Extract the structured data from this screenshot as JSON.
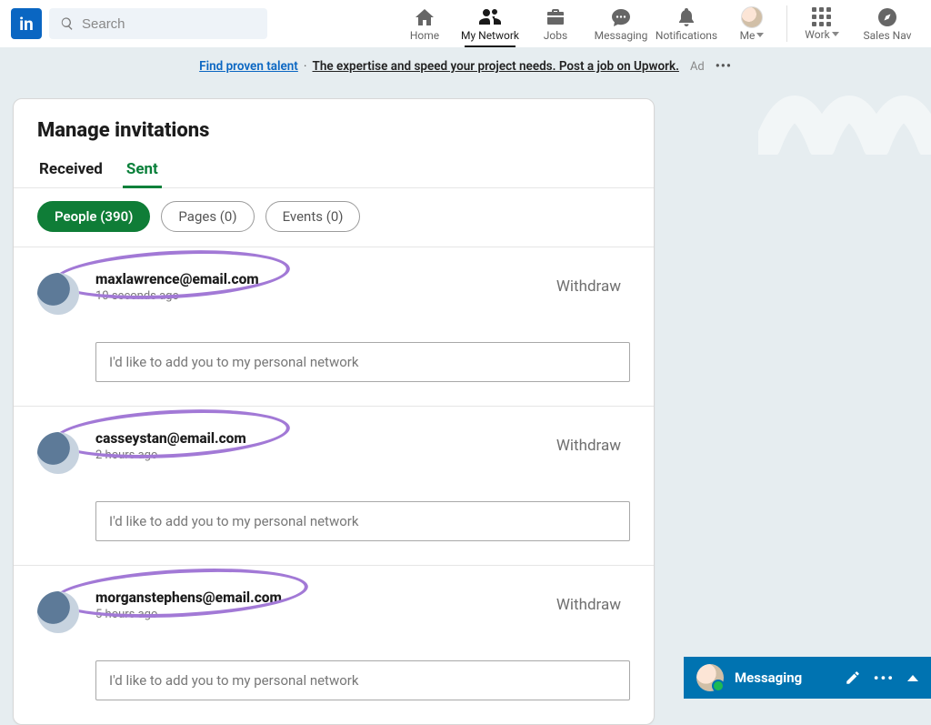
{
  "nav": {
    "search_placeholder": "Search",
    "items": [
      {
        "id": "home",
        "label": "Home"
      },
      {
        "id": "network",
        "label": "My Network"
      },
      {
        "id": "jobs",
        "label": "Jobs"
      },
      {
        "id": "messaging",
        "label": "Messaging"
      },
      {
        "id": "notifications",
        "label": "Notifications"
      },
      {
        "id": "me",
        "label": "Me"
      },
      {
        "id": "work",
        "label": "Work"
      },
      {
        "id": "salesnav",
        "label": "Sales Nav"
      }
    ]
  },
  "ad": {
    "link_text": "Find proven talent",
    "separator": " · ",
    "text": "The expertise and speed your project needs. Post a job on Upwork.",
    "label": "Ad"
  },
  "card": {
    "title": "Manage invitations",
    "tabs": {
      "received": "Received",
      "sent": "Sent"
    },
    "filters": {
      "people": "People (390)",
      "pages": "Pages (0)",
      "events": "Events (0)"
    },
    "withdraw_label": "Withdraw",
    "invitations": [
      {
        "name": "maxlawrence@email.com",
        "time": "10 seconds ago",
        "message": "I'd like to add you to my personal network"
      },
      {
        "name": "casseystan@email.com",
        "time": "2 hours ago",
        "message": "I'd like to add you to my personal network"
      },
      {
        "name": "morganstephens@email.com",
        "time": "5 hours ago",
        "message": "I'd like to add you to my personal network"
      }
    ]
  },
  "messaging_bar": {
    "label": "Messaging"
  }
}
